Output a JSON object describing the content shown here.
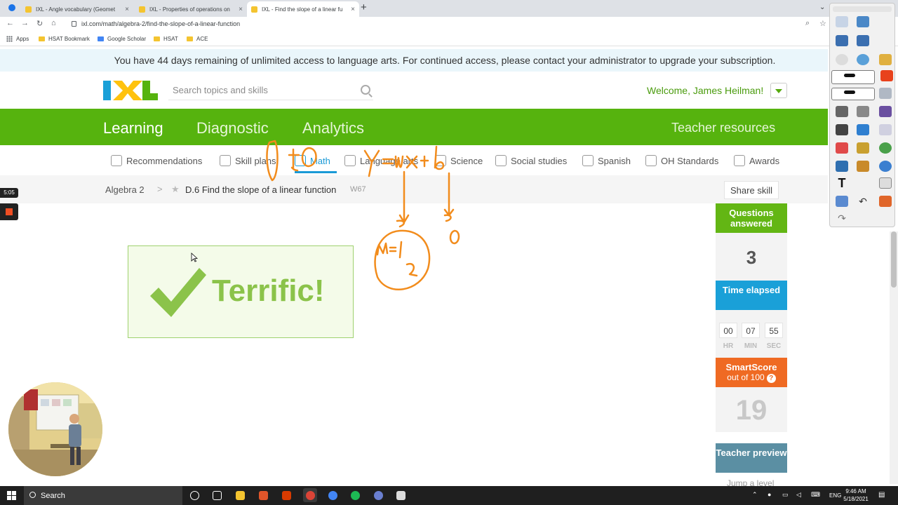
{
  "browser": {
    "tabs": [
      {
        "title": "IXL - Angle vocabulary (Geomet"
      },
      {
        "title": "IXL - Properties of operations on"
      },
      {
        "title": "IXL - Find the slope of a linear fu"
      }
    ],
    "url": "ixl.com/math/algebra-2/find-the-slope-of-a-linear-function",
    "bookmarks": [
      "Apps",
      "HSAT Bookmark",
      "Google Scholar",
      "HSAT",
      "ACE"
    ]
  },
  "banner": {
    "text": "You have 44 days remaining of unlimited access to language arts. For continued access, please contact your administrator to upgrade your subscription."
  },
  "header": {
    "logo": "IXL",
    "search_placeholder": "Search topics and skills",
    "welcome": "Welcome, James Heilman!"
  },
  "main_nav": {
    "items": [
      "Learning",
      "Diagnostic",
      "Analytics"
    ],
    "active": "Learning",
    "teacher_resources": "Teacher resources",
    "color": "#56b30e"
  },
  "subnav": {
    "items": [
      "Recommendations",
      "Skill plans",
      "Math",
      "Language arts",
      "Science",
      "Social studies",
      "Spanish",
      "OH Standards",
      "Awards"
    ],
    "active": "Math"
  },
  "breadcrumb": {
    "subject": "Algebra 2",
    "skill": "D.6 Find the slope of a linear function",
    "code": "W67",
    "share": "Share skill"
  },
  "feedback": {
    "message": "Terrific!"
  },
  "stats": {
    "questions_label": "Questions answered",
    "questions_value": "3",
    "time_label": "Time elapsed",
    "time": {
      "hr": "00",
      "min": "07",
      "sec": "55"
    },
    "time_units": {
      "hr": "HR",
      "min": "MIN",
      "sec": "SEC"
    },
    "smartscore_label": "SmartScore",
    "smartscore_sub": "out of 100",
    "smartscore_value": "19",
    "teacher_preview": "Teacher preview",
    "jump_level": "Jump a level"
  },
  "recorder": {
    "time": "5:05"
  },
  "taskbar": {
    "search": "Search",
    "lang": "ENG",
    "time": "9:46 AM",
    "date": "5/18/2021"
  },
  "colors": {
    "ixl_green": "#56b30e",
    "ixl_blue": "#1aa0d8",
    "smartscore_orange": "#ef6a23",
    "annotation_orange": "#f28c1c"
  }
}
